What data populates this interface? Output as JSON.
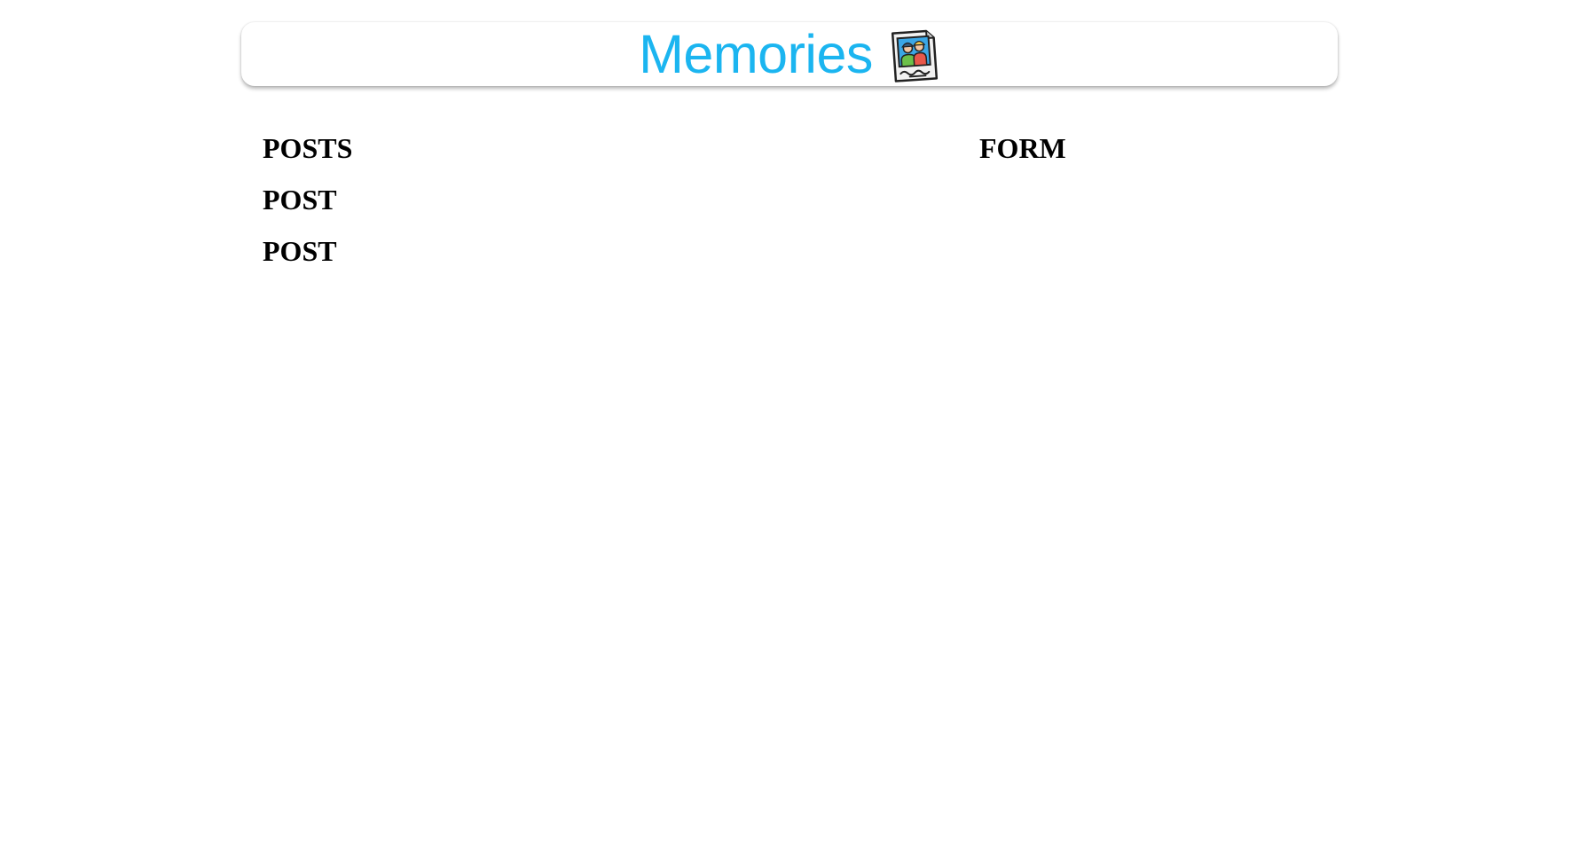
{
  "header": {
    "title": "Memories",
    "logo_icon": "photo-memories-icon",
    "title_color": "#1bb5f0"
  },
  "posts": {
    "heading": "POSTS",
    "items": [
      {
        "label": "POST"
      },
      {
        "label": "POST"
      }
    ]
  },
  "form": {
    "heading": "FORM"
  }
}
